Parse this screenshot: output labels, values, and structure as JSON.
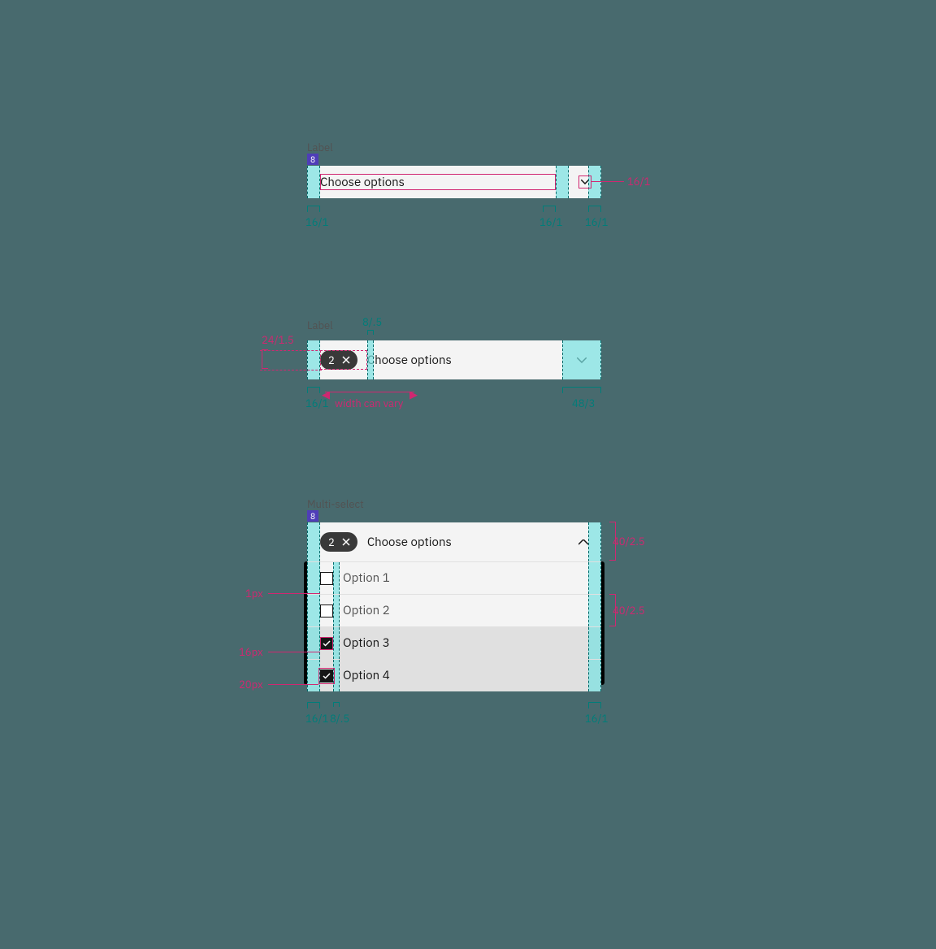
{
  "colors": {
    "teal": "#007d79",
    "pink": "#D12771",
    "bg": "#486a6e",
    "tag": "#393939",
    "field": "#f4f4f4",
    "cyan_overlay": "rgba(120,225,225,0.7)"
  },
  "group1": {
    "label": "Label",
    "gap_badge": "8",
    "placeholder": "Choose options",
    "icon": "chevron-down",
    "annotations": {
      "pad_left": "16/1",
      "inner_gap": "16/1",
      "pad_right": "16/1",
      "icon_box": "16/1"
    }
  },
  "group2": {
    "label": "Label",
    "top_gap": "8/.5",
    "placeholder": "Choose options",
    "tag_count": "2",
    "icon": "chevron-down",
    "annotations": {
      "tag_height": "24/1.5",
      "pad_left": "16/1",
      "width_note": "width can vary",
      "pad_right": "48/3"
    }
  },
  "group3": {
    "label": "Multi-select",
    "gap_badge": "8",
    "placeholder": "Choose options",
    "tag_count": "2",
    "icon": "chevron-up",
    "options": [
      {
        "label": "Option 1",
        "checked": false
      },
      {
        "label": "Option 2",
        "checked": false
      },
      {
        "label": "Option 3",
        "checked": true
      },
      {
        "label": "Option 4",
        "checked": true
      }
    ],
    "annotations": {
      "trigger_h": "40/2.5",
      "row_h": "40/2.5",
      "divider": "1px",
      "checkbox": "16px",
      "checkbox_outer": "20px",
      "pad_left": "16/1",
      "inner_gap": "8/.5",
      "pad_right": "16/1"
    }
  }
}
